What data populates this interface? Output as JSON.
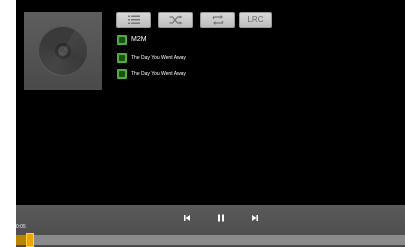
{
  "toolbar": {
    "buttons": [
      {
        "icon": "playlist-icon"
      },
      {
        "icon": "shuffle-icon"
      },
      {
        "icon": "repeat-icon"
      },
      {
        "label": "LRC"
      }
    ]
  },
  "album_art": {
    "icon": "disc-icon"
  },
  "tracks": [
    {
      "title": "M2M",
      "icon": "artist-icon"
    },
    {
      "title": "The Day You Went Away",
      "icon": "album-icon"
    },
    {
      "title": "The Day You Went Away",
      "icon": "song-icon"
    }
  ],
  "player": {
    "elapsed": "0:05",
    "progress": 0.03,
    "controls": [
      "previous-icon",
      "pause-icon",
      "next-icon"
    ]
  },
  "colors": {
    "accent": "#4cae3f",
    "progress": "#f0a500"
  }
}
